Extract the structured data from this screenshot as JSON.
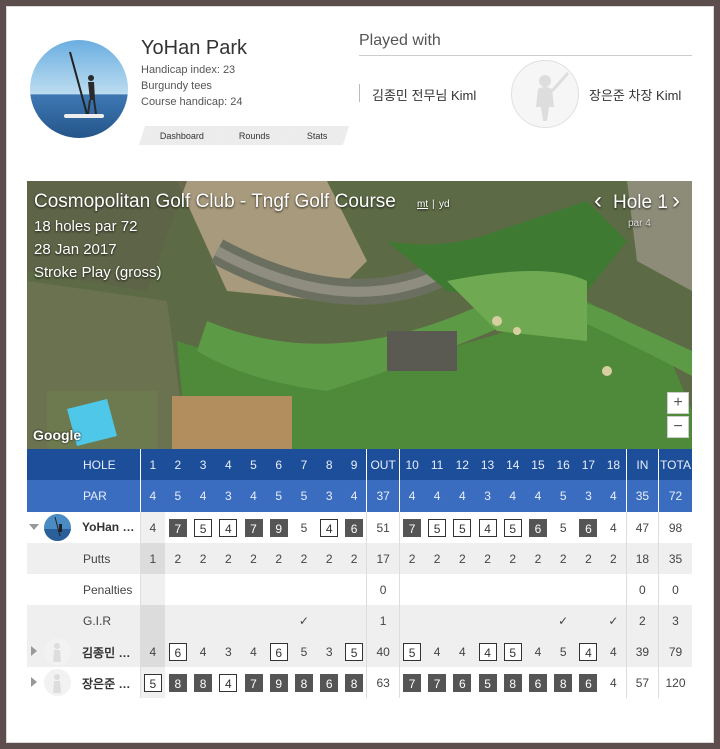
{
  "player": {
    "name": "YoHan Park",
    "handicap_index": "Handicap index: 23",
    "tees": "Burgundy tees",
    "course_handicap": "Course handicap: 24"
  },
  "nav": {
    "dashboard": "Dashboard",
    "rounds": "Rounds",
    "stats": "Stats"
  },
  "played_with": {
    "title": "Played with",
    "mates": [
      "김종민 전무님 Kiml",
      "장은준 차장 Kiml"
    ]
  },
  "course": {
    "name": "Cosmopolitan Golf Club - Tngf Golf Course",
    "unit_mt": "mt",
    "unit_sep": "|",
    "unit_yd": "yd",
    "holes_par": "18 holes par 72",
    "date": "28 Jan 2017",
    "mode": "Stroke Play (gross)",
    "hole_label": "Hole 1",
    "hole_par": "par 4",
    "prev": "‹",
    "next": "›",
    "google": "Google",
    "zoom_in": "+",
    "zoom_out": "−"
  },
  "table": {
    "hole_label": "HOLE",
    "par_label": "PAR",
    "holes": [
      "1",
      "2",
      "3",
      "4",
      "5",
      "6",
      "7",
      "8",
      "9",
      "OUT",
      "10",
      "11",
      "12",
      "13",
      "14",
      "15",
      "16",
      "17",
      "18",
      "IN",
      "TOTA"
    ],
    "par": [
      "4",
      "5",
      "4",
      "3",
      "4",
      "5",
      "5",
      "3",
      "4",
      "37",
      "4",
      "4",
      "4",
      "3",
      "4",
      "4",
      "5",
      "3",
      "4",
      "35",
      "72"
    ],
    "players": [
      {
        "name": "YoHan …",
        "scores": [
          "4",
          "7",
          "5",
          "4",
          "7",
          "9",
          "5",
          "4",
          "6",
          "51",
          "7",
          "5",
          "5",
          "4",
          "5",
          "6",
          "5",
          "6",
          "4",
          "47",
          "98"
        ],
        "marks": [
          "",
          "dbl",
          "bogey",
          "bogey",
          "dbl",
          "dbl",
          "",
          "bogey",
          "dbl",
          "",
          "dbl",
          "bogey",
          "bogey",
          "bogey",
          "bogey",
          "dbl",
          "",
          "dbl",
          "",
          "",
          ""
        ]
      },
      {
        "name": "김종민 …",
        "scores": [
          "4",
          "6",
          "4",
          "3",
          "4",
          "6",
          "5",
          "3",
          "5",
          "40",
          "5",
          "4",
          "4",
          "4",
          "5",
          "4",
          "5",
          "4",
          "4",
          "39",
          "79"
        ],
        "marks": [
          "",
          "bogey",
          "",
          "",
          "",
          "bogey",
          "",
          "",
          "bogey",
          "",
          "bogey",
          "",
          "",
          "bogey",
          "bogey",
          "",
          "",
          "bogey",
          "",
          "",
          ""
        ]
      },
      {
        "name": "장은준 …",
        "scores": [
          "5",
          "8",
          "8",
          "4",
          "7",
          "9",
          "8",
          "6",
          "8",
          "63",
          "7",
          "7",
          "6",
          "5",
          "8",
          "6",
          "8",
          "6",
          "4",
          "57",
          "120"
        ],
        "marks": [
          "bogey",
          "dbl",
          "dbl",
          "bogey",
          "dbl",
          "dbl",
          "dbl",
          "dbl",
          "dbl",
          "",
          "dbl",
          "dbl",
          "dbl",
          "dbl",
          "dbl",
          "dbl",
          "dbl",
          "dbl",
          "",
          "",
          ""
        ]
      }
    ],
    "stats": [
      {
        "label": "Putts",
        "values": [
          "1",
          "2",
          "2",
          "2",
          "2",
          "2",
          "2",
          "2",
          "2",
          "17",
          "2",
          "2",
          "2",
          "2",
          "2",
          "2",
          "2",
          "2",
          "2",
          "18",
          "35"
        ]
      },
      {
        "label": "Penalties",
        "values": [
          "",
          "",
          "",
          "",
          "",
          "",
          "",
          "",
          "",
          "0",
          "",
          "",
          "",
          "",
          "",
          "",
          "",
          "",
          "",
          "0",
          "0"
        ]
      },
      {
        "label": "G.I.R",
        "values": [
          "",
          "",
          "",
          "",
          "",
          "",
          "✓",
          "",
          "",
          "1",
          "",
          "",
          "",
          "",
          "",
          "",
          "✓",
          "",
          "✓",
          "2",
          "3"
        ]
      }
    ]
  }
}
